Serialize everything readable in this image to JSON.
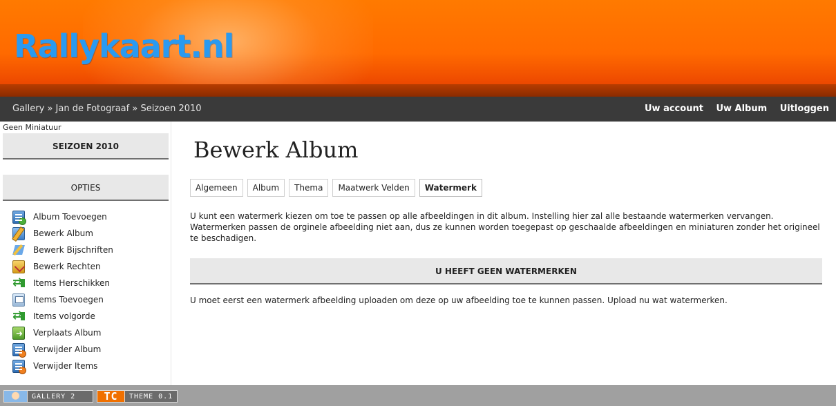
{
  "header": {
    "logo_text": "Rallykaart.nl"
  },
  "nav": {
    "breadcrumb": [
      "Gallery",
      "Jan de Fotograaf",
      "Seizoen 2010"
    ],
    "separator": " » ",
    "links": [
      "Uw account",
      "Uw Album",
      "Uitloggen"
    ]
  },
  "sidebar": {
    "no_thumbnail": "Geen Miniatuur",
    "album_title": "SEIZOEN 2010",
    "options_title": "OPTIES",
    "items": [
      {
        "label": "Album Toevoegen",
        "icon": "add-album-icon"
      },
      {
        "label": "Bewerk Album",
        "icon": "edit-album-icon"
      },
      {
        "label": "Bewerk Bijschriften",
        "icon": "edit-captions-icon"
      },
      {
        "label": "Bewerk Rechten",
        "icon": "edit-permissions-icon"
      },
      {
        "label": "Items Herschikken",
        "icon": "rearrange-icon"
      },
      {
        "label": "Items Toevoegen",
        "icon": "add-items-icon"
      },
      {
        "label": "Items volgorde",
        "icon": "sort-icon"
      },
      {
        "label": "Verplaats Album",
        "icon": "move-album-icon"
      },
      {
        "label": "Verwijder Album",
        "icon": "delete-album-icon"
      },
      {
        "label": "Verwijder Items",
        "icon": "delete-items-icon"
      }
    ]
  },
  "main": {
    "title": "Bewerk Album",
    "tabs": [
      "Algemeen",
      "Album",
      "Thema",
      "Maatwerk Velden",
      "Watermerk"
    ],
    "active_tab": "Watermerk",
    "description": "U kunt een watermerk kiezen om toe te passen op alle afbeeldingen in dit album. Instelling hier zal alle bestaande watermerken vervangen. Watermerken passen de orginele afbeelding niet aan, dus ze kunnen worden toegepast op geschaalde afbeeldingen en miniaturen zonder het origineel te beschadigen.",
    "section_heading": "U HEEFT GEEN WATERMERKEN",
    "note": "U moet eerst een watermerk afbeelding uploaden om deze op uw afbeelding toe te kunnen passen. Upload nu wat watermerken."
  },
  "footer": {
    "badges": [
      "GALLERY 2",
      "THEME 0.1"
    ],
    "theme_logo": "TC"
  },
  "colors": {
    "header_orange": "#ff7a00",
    "logo_blue": "#2a9af0",
    "navbar": "#3a3a3a",
    "section_bg": "#e8e8e8",
    "footer": "#a0a0a0"
  }
}
